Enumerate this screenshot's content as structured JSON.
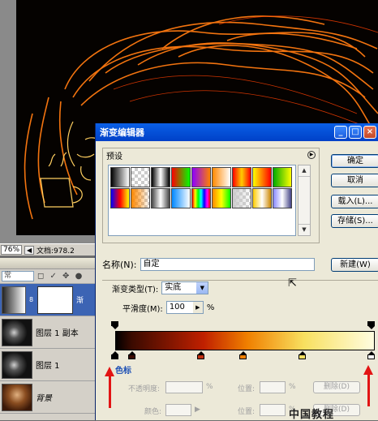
{
  "statusbar": {
    "zoom": "76%",
    "doc_text": "文档:978.2"
  },
  "layers_panel": {
    "mode_label": "常",
    "lock_icons": "◻ ✓ ✥ ●",
    "layers": [
      {
        "name": "渐",
        "active": true,
        "type": "gradient"
      },
      {
        "name": "图层 1 副本",
        "active": false,
        "type": "fire"
      },
      {
        "name": "图层 1",
        "active": false,
        "type": "fire"
      },
      {
        "name": "背景",
        "active": false,
        "type": "face"
      }
    ]
  },
  "dialog": {
    "title": "渐变编辑器",
    "presets_label": "预设",
    "buttons": {
      "ok": "确定",
      "cancel": "取消",
      "load": "载入(L)...",
      "save": "存储(S)..."
    },
    "name_label": "名称(N):",
    "name_value": "自定",
    "new_button": "新建(W)",
    "gradient_type_label": "渐变类型(T):",
    "gradient_type_value": "实底",
    "smoothness_label": "平滑度(M):",
    "smoothness_value": "100",
    "smoothness_unit": "%",
    "stops_group_label": "色标",
    "opacity_label": "不透明度:",
    "opacity_unit": "%",
    "location_label_1": "位置:",
    "location_unit_1": "%",
    "delete_button_1": "删除(D)",
    "color_label": "颜色:",
    "location_label_2": "位置:",
    "location_unit_2": "%",
    "delete_button_2": "删除(D)"
  },
  "presets": [
    "#000-#fff",
    "checker-fade",
    "#000-#fff-#000",
    "#f00-#0f0",
    "#8b00ff-#ff8000",
    "#f80-#fff",
    "#f00-#fc0-#f00",
    "#ff0-#f00",
    "#0a0-#ff0",
    "#00f-#f00-#ff0",
    "checker-#f80",
    "#444-#fff-#444",
    "#08f-#fff",
    "rainbow",
    "#f80-#ff0-#0f0",
    "checker-#ccc",
    "#fc0-#fff-#c80",
    "#88f-#fff-#448"
  ],
  "colors": {
    "title_blue": "#0a50dc",
    "accent_red": "#e21414",
    "stop_colors": [
      "#000000",
      "#3a0a00",
      "#c03010",
      "#f08000",
      "#f8e060",
      "#ffffff"
    ]
  },
  "watermark": "中国教程"
}
